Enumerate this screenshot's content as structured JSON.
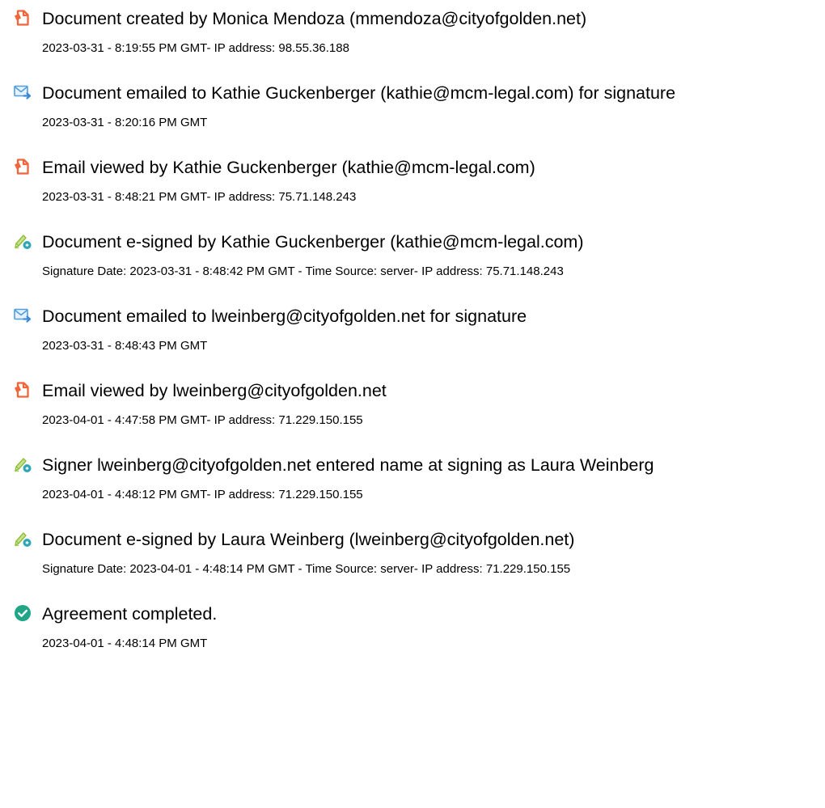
{
  "colors": {
    "document_icon": "#f1653a",
    "email_icon": "#4f9ee0",
    "email_arrow": "#3b8ad6",
    "signed_icon": "#8fbf3a",
    "signed_badge": "#2fa6b8",
    "completed_icon": "#21a587",
    "text": "#000000"
  },
  "events": [
    {
      "icon": "document-icon",
      "title": "Document created by Monica Mendoza (mmendoza@cityofgolden.net)",
      "detail": "2023-03-31 - 8:19:55 PM GMT- IP address: 98.55.36.188"
    },
    {
      "icon": "email-sent-icon",
      "title": "Document emailed to Kathie Guckenberger (kathie@mcm-legal.com) for signature",
      "detail": "2023-03-31 - 8:20:16 PM GMT"
    },
    {
      "icon": "document-icon",
      "title": "Email viewed by Kathie Guckenberger (kathie@mcm-legal.com)",
      "detail": "2023-03-31 - 8:48:21 PM GMT- IP address: 75.71.148.243"
    },
    {
      "icon": "e-sign-icon",
      "title": "Document e-signed by Kathie Guckenberger (kathie@mcm-legal.com)",
      "detail": "Signature Date: 2023-03-31 - 8:48:42 PM GMT - Time Source: server- IP address: 75.71.148.243"
    },
    {
      "icon": "email-sent-icon",
      "title": "Document emailed to lweinberg@cityofgolden.net for signature",
      "detail": "2023-03-31 - 8:48:43 PM GMT"
    },
    {
      "icon": "document-icon",
      "title": "Email viewed by lweinberg@cityofgolden.net",
      "detail": "2023-04-01 - 4:47:58 PM GMT- IP address: 71.229.150.155"
    },
    {
      "icon": "e-sign-icon",
      "title": "Signer lweinberg@cityofgolden.net entered name at signing as Laura Weinberg",
      "detail": "2023-04-01 - 4:48:12 PM GMT- IP address: 71.229.150.155"
    },
    {
      "icon": "e-sign-icon",
      "title": "Document e-signed by Laura Weinberg (lweinberg@cityofgolden.net)",
      "detail": "Signature Date: 2023-04-01 - 4:48:14 PM GMT - Time Source: server- IP address: 71.229.150.155"
    },
    {
      "icon": "check-circle-icon",
      "title": "Agreement completed.",
      "detail": "2023-04-01 - 4:48:14 PM GMT"
    }
  ]
}
